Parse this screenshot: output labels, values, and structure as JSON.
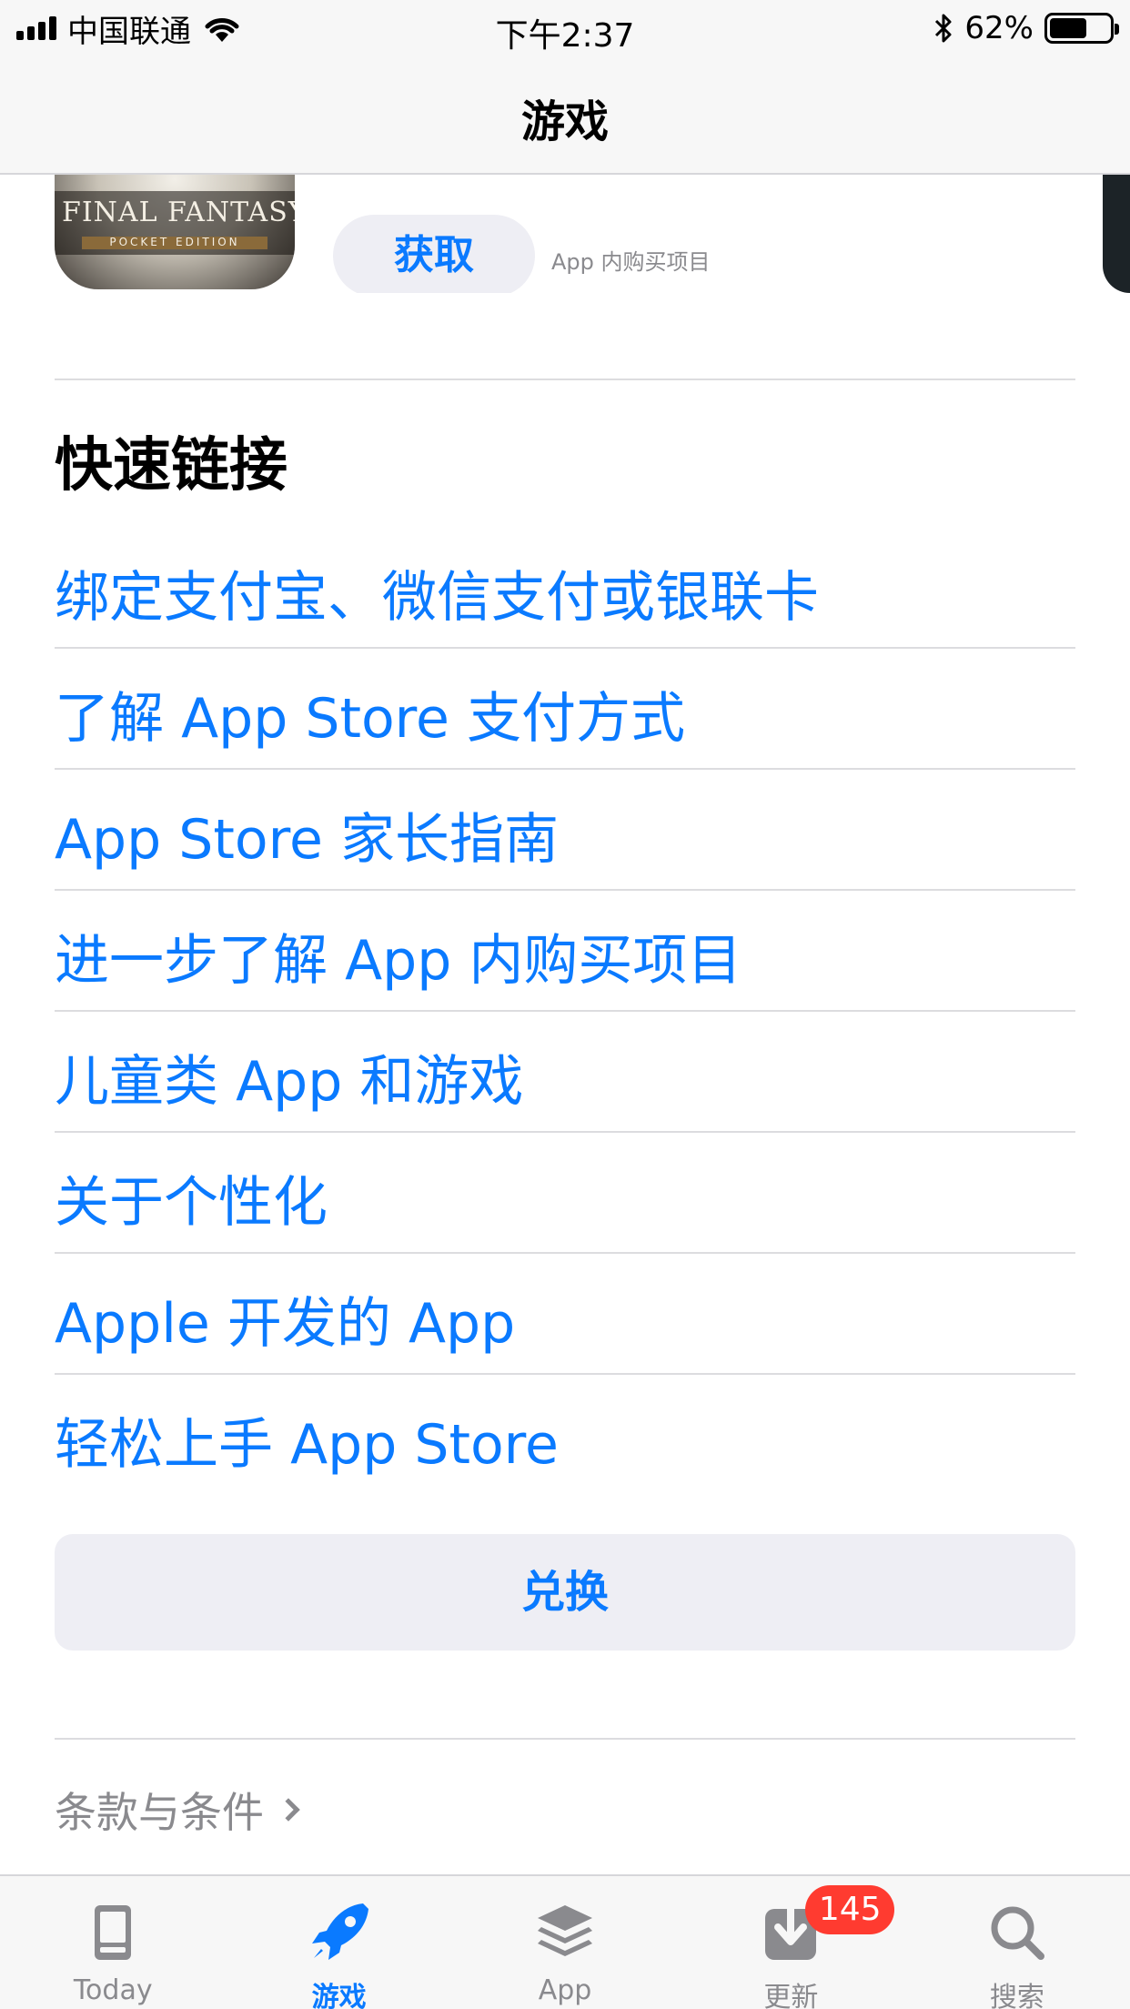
{
  "status_bar": {
    "carrier": "中国联通",
    "time": "下午2:37",
    "battery_percent": "62%",
    "battery_level": 0.62,
    "icons": [
      "signal-icon",
      "wifi-icon",
      "bluetooth-icon",
      "battery-icon"
    ]
  },
  "nav": {
    "title": "游戏"
  },
  "app_card": {
    "icon_text": "FINAL FANTASY XV",
    "icon_subtext": "POCKET EDITION",
    "get_label": "获取",
    "iap_note": "App 内购买项目"
  },
  "quick_links": {
    "title": "快速链接",
    "items": [
      {
        "label": "绑定支付宝、微信支付或银联卡"
      },
      {
        "label": "了解 App Store 支付方式"
      },
      {
        "label": "App Store 家长指南"
      },
      {
        "label": "进一步了解 App 内购买项目"
      },
      {
        "label": "儿童类 App 和游戏"
      },
      {
        "label": "关于个性化"
      },
      {
        "label": "Apple 开发的 App"
      },
      {
        "label": "轻松上手 App Store"
      }
    ]
  },
  "redeem": {
    "label": "兑换"
  },
  "terms": {
    "label": "条款与条件"
  },
  "tab_bar": {
    "tabs": [
      {
        "label": "Today",
        "icon": "today-icon",
        "active": false
      },
      {
        "label": "游戏",
        "icon": "rocket-icon",
        "active": true
      },
      {
        "label": "App",
        "icon": "layers-icon",
        "active": false
      },
      {
        "label": "更新",
        "icon": "download-icon",
        "active": false,
        "badge": "145"
      },
      {
        "label": "搜索",
        "icon": "search-icon",
        "active": false
      }
    ]
  },
  "colors": {
    "accent": "#0a7aff",
    "badge": "#ff3b30",
    "secondary_text": "#8a8a8e",
    "button_bg": "#eeeef4"
  }
}
